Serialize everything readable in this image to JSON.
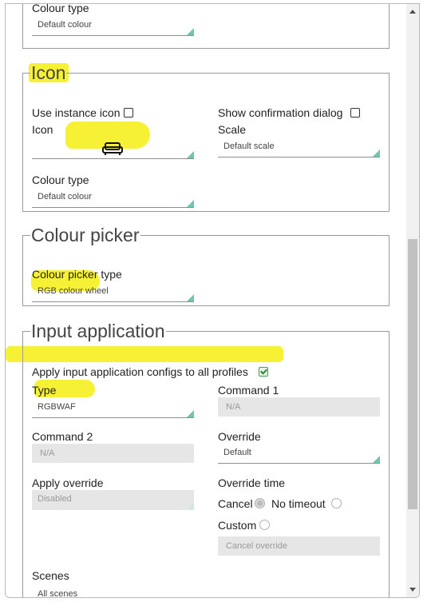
{
  "colour_type_top": {
    "label": "Colour type",
    "value": "Default colour"
  },
  "icon_section": {
    "title": "Icon",
    "use_instance_icon_label": "Use instance icon",
    "show_confirmation_label": "Show confirmation dialog",
    "icon_label": "Icon",
    "icon_value_symbol": "sofa-icon",
    "scale_label": "Scale",
    "scale_value": "Default scale",
    "colour_type_label": "Colour type",
    "colour_type_value": "Default colour"
  },
  "colour_picker_section": {
    "title": "Colour picker",
    "type_label": "Colour picker type",
    "type_value": "RGB colour wheel"
  },
  "input_application_section": {
    "title": "Input application",
    "apply_all_label": "Apply input application configs to all profiles",
    "apply_all_checked": true,
    "type_label": "Type",
    "type_value": "RGBWAF",
    "command1_label": "Command 1",
    "command1_value": "N/A",
    "command2_label": "Command 2",
    "command2_value": "N/A",
    "override_label": "Override",
    "override_value": "Default",
    "apply_override_label": "Apply override",
    "apply_override_value": "Disabled",
    "override_time_label": "Override time",
    "cancel_label": "Cancel",
    "no_timeout_label": "No timeout",
    "custom_label": "Custom",
    "cancel_override_value": "Cancel override",
    "scenes_label": "Scenes",
    "scenes_value": "All scenes"
  },
  "colors": {
    "accent_triangle": "#6fc6ad",
    "highlight": "#f7f02a"
  }
}
